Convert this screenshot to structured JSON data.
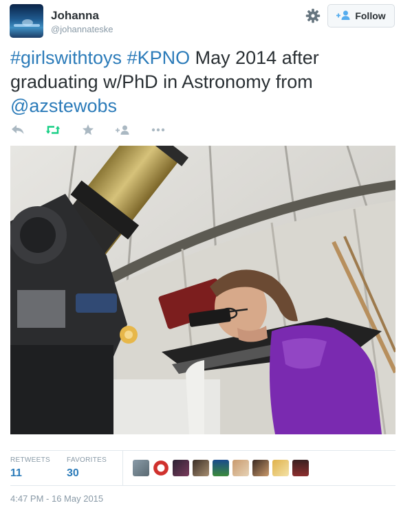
{
  "user": {
    "name": "Johanna",
    "handle": "@johannateske"
  },
  "follow_label": "Follow",
  "tweet": {
    "hashtag1": "#girlswithtoys",
    "hashtag2": "#KPNO",
    "text_mid": " May 2014 after graduating w/PhD in Astronomy from ",
    "mention": "@azstewobs"
  },
  "actions": [
    "reply-icon",
    "retweet-icon",
    "favorite-icon",
    "follow-icon",
    "more-icon"
  ],
  "stats": {
    "retweets_label": "RETWEETS",
    "retweets_count": "11",
    "favorites_label": "FAVORITES",
    "favorites_count": "30"
  },
  "timestamp": "4:47 PM - 16 May 2015",
  "colors": {
    "link": "#2b7bb9",
    "retweet": "#19cf86",
    "muted": "#8899a6",
    "text": "#292f33"
  }
}
